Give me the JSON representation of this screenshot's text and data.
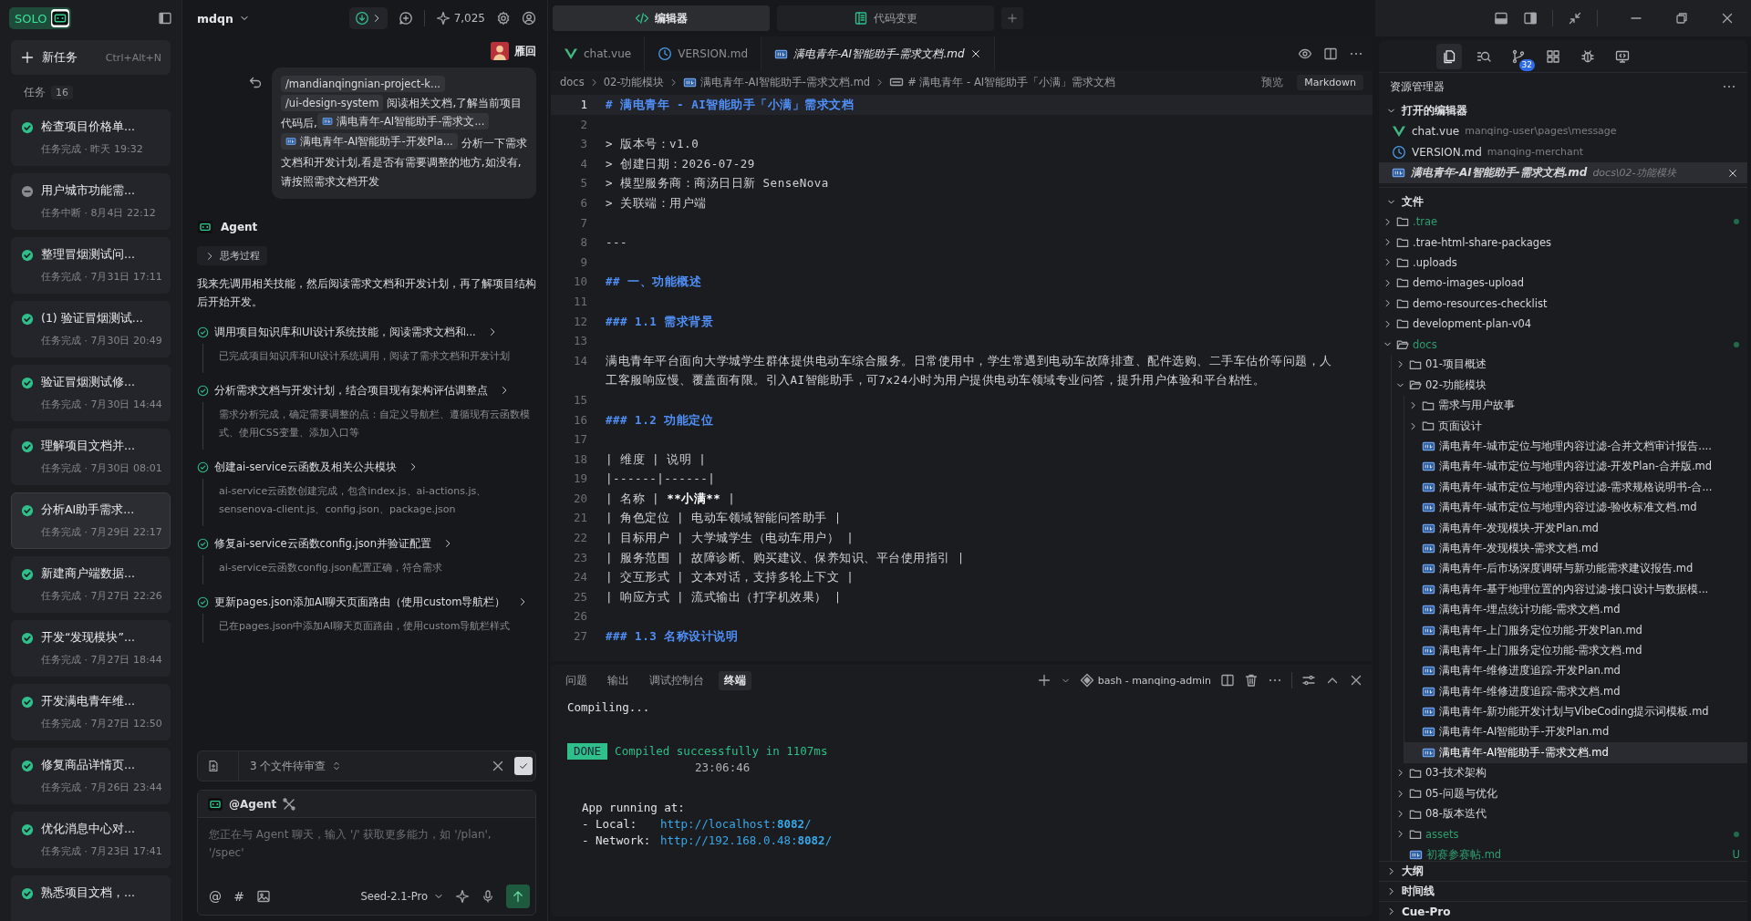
{
  "sidebar": {
    "logo": "SOLO",
    "new_task": {
      "label": "新任务",
      "shortcut": "Ctrl+Alt+N"
    },
    "tasks_label": "任务",
    "task_count": "16",
    "tasks": [
      {
        "title": "检查项目价格单...",
        "kind": "done",
        "meta": "任务完成 · 昨天 19:32",
        "selected": false
      },
      {
        "title": "用户城市功能需...",
        "kind": "interrupted",
        "meta": "任务中断 · 8月4日 22:12",
        "selected": false
      },
      {
        "title": "整理冒烟测试问...",
        "kind": "done",
        "meta": "任务完成 · 7月31日 17:11",
        "selected": false
      },
      {
        "title": "(1) 验证冒烟测试...",
        "kind": "done",
        "meta": "任务完成 · 7月30日 20:49",
        "selected": false
      },
      {
        "title": "验证冒烟测试修...",
        "kind": "done",
        "meta": "任务完成 · 7月30日 14:44",
        "selected": false
      },
      {
        "title": "理解项目文档并...",
        "kind": "done",
        "meta": "任务完成 · 7月30日 08:01",
        "selected": false
      },
      {
        "title": "分析AI助手需求...",
        "kind": "done",
        "meta": "任务完成 · 7月29日 22:17",
        "selected": true
      },
      {
        "title": "新建商户端数据...",
        "kind": "done",
        "meta": "任务完成 · 7月27日 22:26",
        "selected": false
      },
      {
        "title": "开发“发现模块”...",
        "kind": "done",
        "meta": "任务完成 · 7月27日 18:44",
        "selected": false
      },
      {
        "title": "开发满电青年维...",
        "kind": "done",
        "meta": "任务完成 · 7月27日 12:50",
        "selected": false
      },
      {
        "title": "修复商品详情页...",
        "kind": "done",
        "meta": "任务完成 · 7月26日 23:44",
        "selected": false
      },
      {
        "title": "优化消息中心对...",
        "kind": "done",
        "meta": "任务完成 · 7月23日 17:41",
        "selected": false
      },
      {
        "title": "熟悉项目文档，...",
        "kind": "done",
        "selected": false
      }
    ]
  },
  "chat": {
    "project": "mdqn",
    "credits": "7,025",
    "user": {
      "name": "雁回"
    },
    "message": [
      {
        "kind": "path",
        "text": "/mandianqingnian-project-k..."
      },
      {
        "kind": "path",
        "text": "/ui-design-system"
      },
      {
        "kind": "text",
        "text": "阅读相关文档,了解当前项目代码后,"
      },
      {
        "kind": "file",
        "text": "满电青年-AI智能助手-需求文..."
      },
      {
        "kind": "file",
        "text": "满电青年-AI智能助手-开发Pla..."
      },
      {
        "kind": "text",
        "text": "分析一下需求文档和开发计划,看是否有需要调整的地方,如没有,请按照需求文档开发"
      }
    ],
    "agent": {
      "name": "Agent",
      "thinking": {
        "label": "思考过程",
        "expanded": false
      },
      "intro": "我来先调用相关技能，然后阅读需求文档和开发计划，再了解项目结构后开始开发。",
      "steps": [
        {
          "title": "调用项目知识库和UI设计系统技能，阅读需求文档和...",
          "detail": "已完成项目知识库和UI设计系统调用，阅读了需求文档和开发计划",
          "done": true
        },
        {
          "title": "分析需求文档与开发计划，结合项目现有架构评估调整点",
          "detail": "需求分析完成，确定需要调整的点：自定义导航栏、遵循现有云函数模式、使用CSS变量、添加入口等",
          "done": true
        },
        {
          "title": "创建ai-service云函数及相关公共模块",
          "detail": "ai-service云函数创建完成，包含index.js、ai-actions.js、sensenova-client.js、config.json、package.json",
          "done": true
        },
        {
          "title": "修复ai-service云函数config.json并验证配置",
          "detail": "ai-service云函数config.json配置正确，符合需求",
          "done": true
        },
        {
          "title": "更新pages.json添加AI聊天页面路由（使用custom导航栏）",
          "detail": "已在pages.json中添加AI聊天页面路由，使用custom导航栏样式",
          "done": true
        }
      ]
    },
    "review": {
      "label": "3 个文件待审查"
    },
    "composer": {
      "mention": "@Agent",
      "placeholder": "您正在与 Agent 聊天，输入 '/' 获取更多能力，如 '/plan', '/spec'",
      "tools": [
        "@",
        "#"
      ],
      "model": "Seed-2.1-Pro"
    }
  },
  "editor": {
    "views": [
      {
        "label": "编辑器",
        "kind": "code",
        "selected": true
      },
      {
        "label": "代码变更",
        "kind": "changes",
        "selected": false
      }
    ],
    "tabs": [
      {
        "name": "chat.vue",
        "kind": "vue",
        "selected": false,
        "preview": false
      },
      {
        "name": "VERSION.md",
        "kind": "version",
        "selected": false,
        "preview": false
      },
      {
        "name": "满电青年-AI智能助手-需求文档.md",
        "kind": "markdown",
        "selected": true,
        "preview": true
      }
    ],
    "breadcrumb": [
      {
        "text": "docs",
        "kind": "folder"
      },
      {
        "text": "02-功能模块",
        "kind": "folder"
      },
      {
        "text": "满电青年-AI智能助手-需求文档.md",
        "kind": "file"
      },
      {
        "text": "# 满电青年 - AI智能助手「小满」需求文档",
        "kind": "symbol"
      }
    ],
    "preview": "预览",
    "language": "Markdown",
    "lines": [
      {
        "n": "1",
        "kind": "heading",
        "text": "# 满电青年 - AI智能助手「小满」需求文档",
        "current": true
      },
      {
        "n": "2",
        "kind": "blank",
        "current": false
      },
      {
        "n": "3",
        "kind": "quote",
        "text": "> 版本号：v1.0",
        "current": false
      },
      {
        "n": "4",
        "kind": "quote",
        "text": "> 创建日期：2026-07-29",
        "current": false
      },
      {
        "n": "5",
        "kind": "quote",
        "text": "> 模型服务商：商汤日日新 SenseNova",
        "current": false
      },
      {
        "n": "6",
        "kind": "quote",
        "text": "> 关联端：用户端",
        "current": false
      },
      {
        "n": "7",
        "kind": "blank",
        "current": false
      },
      {
        "n": "8",
        "kind": "plain",
        "text": "---",
        "current": false
      },
      {
        "n": "9",
        "kind": "blank",
        "current": false
      },
      {
        "n": "10",
        "kind": "heading",
        "text": "## 一、功能概述",
        "current": false
      },
      {
        "n": "11",
        "kind": "blank",
        "current": false
      },
      {
        "n": "12",
        "kind": "heading",
        "text": "### 1.1 需求背景",
        "current": false
      },
      {
        "n": "13",
        "kind": "blank",
        "current": false
      },
      {
        "n": "14",
        "kind": "plain",
        "text": "满电青年平台面向大学城学生群体提供电动车综合服务。日常使用中，学生常遇到电动车故障排查、配件选购、二手车估价等问题，人工客服响应慢、覆盖面有限。引入AI智能助手，可7x24小时为用户提供电动车领域专业问答，提升用户体验和平台粘性。",
        "current": false
      },
      {
        "n": "15",
        "kind": "blank",
        "current": false
      },
      {
        "n": "16",
        "kind": "heading",
        "text": "### 1.2 功能定位",
        "current": false
      },
      {
        "n": "17",
        "kind": "blank",
        "current": false
      },
      {
        "n": "18",
        "kind": "plain",
        "text": "| 维度 | 说明 |",
        "current": false
      },
      {
        "n": "19",
        "kind": "plain",
        "text": "|------|------|",
        "current": false
      },
      {
        "n": "20",
        "kind": "plain",
        "parts": [
          {
            "text": "| 名称 | ",
            "strong": false
          },
          {
            "text": "**小满**",
            "strong": true
          },
          {
            "text": " |",
            "strong": false
          }
        ],
        "current": false
      },
      {
        "n": "21",
        "kind": "plain",
        "text": "| 角色定位 | 电动车领域智能问答助手 |",
        "current": false
      },
      {
        "n": "22",
        "kind": "plain",
        "text": "| 目标用户 | 大学城学生（电动车用户） |",
        "current": false
      },
      {
        "n": "23",
        "kind": "plain",
        "text": "| 服务范围 | 故障诊断、购买建议、保养知识、平台使用指引 |",
        "current": false
      },
      {
        "n": "24",
        "kind": "plain",
        "text": "| 交互形式 | 文本对话，支持多轮上下文 |",
        "current": false
      },
      {
        "n": "25",
        "kind": "plain",
        "text": "| 响应方式 | 流式输出（打字机效果） |",
        "current": false
      },
      {
        "n": "26",
        "kind": "blank",
        "current": false
      },
      {
        "n": "27",
        "kind": "heading",
        "text": "### 1.3 名称设计说明",
        "current": false
      }
    ]
  },
  "terminal": {
    "tabs": [
      {
        "label": "问题",
        "selected": false
      },
      {
        "label": "输出",
        "selected": false
      },
      {
        "label": "调试控制台",
        "selected": false
      },
      {
        "label": "终端",
        "selected": true
      }
    ],
    "shell": "bash - manqing-admin",
    "lines": [
      {
        "kind": "plain",
        "text": "Compiling..."
      },
      {
        "kind": "blank"
      },
      {
        "kind": "done",
        "badge": "DONE",
        "text": "Compiled successfully in 1107ms"
      },
      {
        "kind": "time",
        "text": "23:06:46"
      },
      {
        "kind": "blank"
      },
      {
        "kind": "note",
        "text": "App running at:"
      },
      {
        "kind": "link",
        "label": "- Local:",
        "url": "http://localhost:**8082**/"
      },
      {
        "kind": "link",
        "label": "- Network:",
        "url": "http://192.168.0.48:**8082**/"
      }
    ]
  },
  "explorer": {
    "source_control_badge": "32",
    "title": "资源管理器",
    "open_editors": {
      "title": "打开的编辑器",
      "expanded": true,
      "items": [
        {
          "name": "chat.vue",
          "path": "manqing-user\\pages\\message",
          "kind": "vue",
          "selected": false,
          "preview": false
        },
        {
          "name": "VERSION.md",
          "path": "manqing-merchant",
          "kind": "version",
          "selected": false,
          "preview": false
        },
        {
          "name": "满电青年-AI智能助手-需求文档.md",
          "path": "docs\\02-功能模块",
          "kind": "markdown",
          "selected": true,
          "preview": true
        }
      ]
    },
    "files": {
      "title": "文件",
      "expanded": true,
      "tree": [
        {
          "name": ".trae",
          "kind": "folder",
          "expanded": false,
          "changed": true,
          "selected": false
        },
        {
          "name": ".trae-html-share-packages",
          "kind": "folder",
          "expanded": false,
          "changed": false,
          "selected": false
        },
        {
          "name": ".uploads",
          "kind": "folder",
          "expanded": false,
          "changed": false,
          "selected": false
        },
        {
          "name": "demo-images-upload",
          "kind": "folder",
          "expanded": false,
          "changed": false,
          "selected": false
        },
        {
          "name": "demo-resources-checklist",
          "kind": "folder",
          "expanded": false,
          "changed": false,
          "selected": false
        },
        {
          "name": "development-plan-v04",
          "kind": "folder",
          "expanded": false,
          "changed": false,
          "selected": false
        },
        {
          "name": "docs",
          "kind": "folder",
          "expanded": true,
          "changed": true,
          "selected": false,
          "children": [
            {
              "name": "01-项目概述",
              "kind": "folder",
              "expanded": false,
              "changed": false,
              "selected": false
            },
            {
              "name": "02-功能模块",
              "kind": "folder",
              "expanded": true,
              "changed": false,
              "selected": false,
              "children": [
                {
                  "name": "需求与用户故事",
                  "kind": "folder",
                  "expanded": false,
                  "changed": false,
                  "selected": false
                },
                {
                  "name": "页面设计",
                  "kind": "folder",
                  "expanded": false,
                  "changed": false,
                  "selected": false
                },
                {
                  "name": "满电青年-城市定位与地理内容过滤-合并文档审计报告....",
                  "kind": "file",
                  "changed": false,
                  "selected": false
                },
                {
                  "name": "满电青年-城市定位与地理内容过滤-开发Plan-合并版.md",
                  "kind": "file",
                  "changed": false,
                  "selected": false
                },
                {
                  "name": "满电青年-城市定位与地理内容过滤-需求规格说明书-合...",
                  "kind": "file",
                  "changed": false,
                  "selected": false
                },
                {
                  "name": "满电青年-城市定位与地理内容过滤-验收标准文档.md",
                  "kind": "file",
                  "changed": false,
                  "selected": false
                },
                {
                  "name": "满电青年-发现模块-开发Plan.md",
                  "kind": "file",
                  "changed": false,
                  "selected": false
                },
                {
                  "name": "满电青年-发现模块-需求文档.md",
                  "kind": "file",
                  "changed": false,
                  "selected": false
                },
                {
                  "name": "满电青年-后市场深度调研与新功能需求建议报告.md",
                  "kind": "file",
                  "changed": false,
                  "selected": false
                },
                {
                  "name": "满电青年-基于地理位置的内容过滤-接口设计与数据模...",
                  "kind": "file",
                  "changed": false,
                  "selected": false
                },
                {
                  "name": "满电青年-埋点统计功能-需求文档.md",
                  "kind": "file",
                  "changed": false,
                  "selected": false
                },
                {
                  "name": "满电青年-上门服务定位功能-开发Plan.md",
                  "kind": "file",
                  "changed": false,
                  "selected": false
                },
                {
                  "name": "满电青年-上门服务定位功能-需求文档.md",
                  "kind": "file",
                  "changed": false,
                  "selected": false
                },
                {
                  "name": "满电青年-维修进度追踪-开发Plan.md",
                  "kind": "file",
                  "changed": false,
                  "selected": false
                },
                {
                  "name": "满电青年-维修进度追踪-需求文档.md",
                  "kind": "file",
                  "changed": false,
                  "selected": false
                },
                {
                  "name": "满电青年-新功能开发计划与VibeCoding提示词模板.md",
                  "kind": "file",
                  "changed": false,
                  "selected": false
                },
                {
                  "name": "满电青年-AI智能助手-开发Plan.md",
                  "kind": "file",
                  "changed": false,
                  "selected": false
                },
                {
                  "name": "满电青年-AI智能助手-需求文档.md",
                  "kind": "file",
                  "changed": false,
                  "selected": true
                }
              ]
            },
            {
              "name": "03-技术架构",
              "kind": "folder",
              "expanded": false,
              "changed": false,
              "selected": false
            },
            {
              "name": "05-问题与优化",
              "kind": "folder",
              "expanded": false,
              "changed": false,
              "selected": false
            },
            {
              "name": "08-版本迭代",
              "kind": "folder",
              "expanded": false,
              "changed": false,
              "selected": false
            },
            {
              "name": "assets",
              "kind": "folder",
              "expanded": false,
              "changed": true,
              "selected": false
            },
            {
              "name": "初赛参赛帖.md",
              "kind": "file",
              "changed": true,
              "badge": "U",
              "selected": false
            }
          ]
        }
      ]
    },
    "sections": [
      {
        "title": "大纲",
        "expanded": false
      },
      {
        "title": "时间线",
        "expanded": false
      },
      {
        "title": "Cue-Pro",
        "expanded": false
      }
    ]
  }
}
